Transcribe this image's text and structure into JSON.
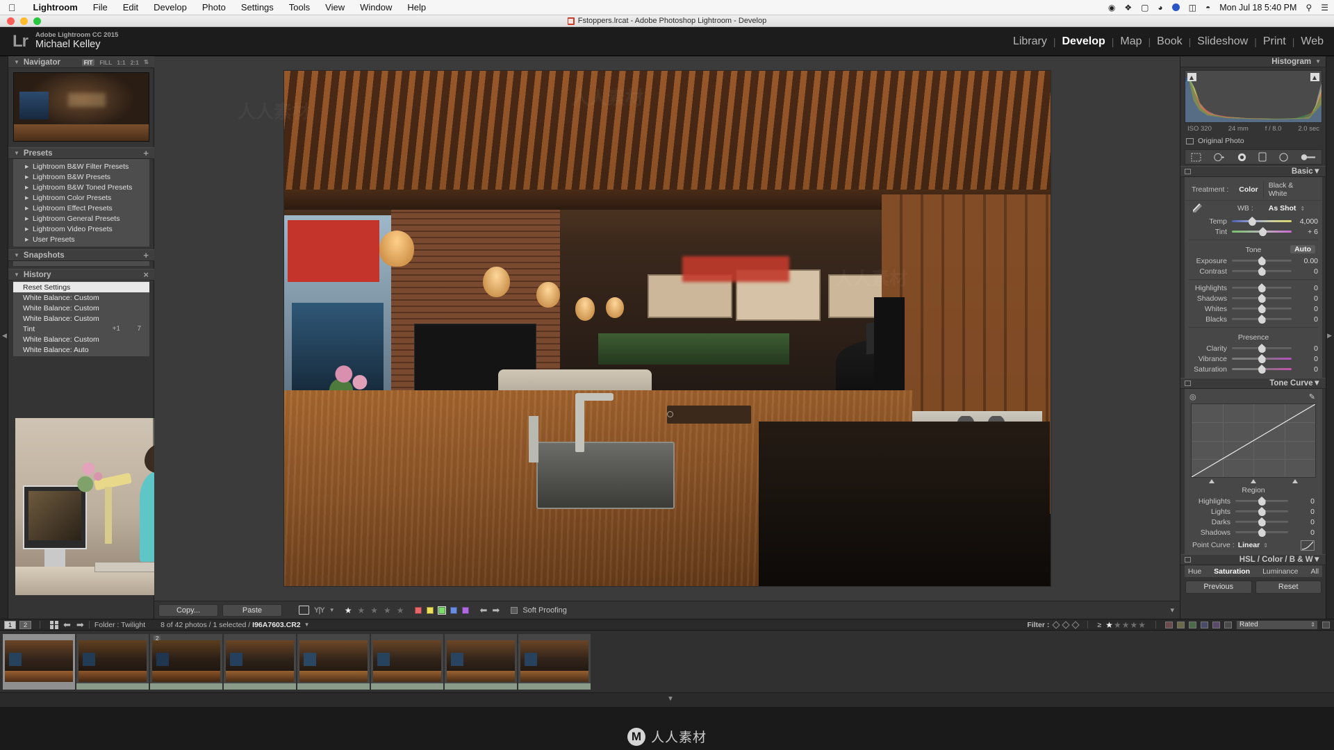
{
  "mac_menu": {
    "apple_icon": "apple-icon",
    "items": [
      "Lightroom",
      "File",
      "Edit",
      "Develop",
      "Photo",
      "Settings",
      "Tools",
      "View",
      "Window",
      "Help"
    ],
    "status_icons": [
      "record-icon",
      "dropbox-icon",
      "app-icon",
      "creative-cloud-icon",
      "blue-dot-icon",
      "airplay-icon",
      "wifi-icon"
    ],
    "clock": "Mon Jul 18  5:40 PM",
    "search_icon": "search-icon",
    "notification_icon": "notification-center-icon"
  },
  "window": {
    "title": "Fstoppers.lrcat - Adobe Photoshop Lightroom - Develop",
    "doc_icon": "lightroom-catalog-icon"
  },
  "identity": {
    "logo": "Lr",
    "product": "Adobe Lightroom CC 2015",
    "user": "Michael Kelley"
  },
  "modules": {
    "items": [
      "Library",
      "Develop",
      "Map",
      "Book",
      "Slideshow",
      "Print",
      "Web"
    ],
    "active": "Develop"
  },
  "left_panel": {
    "navigator": {
      "title": "Navigator",
      "zoom_options": [
        "FIT",
        "FILL",
        "1:1",
        "2:1"
      ],
      "active_zoom": "FIT"
    },
    "presets": {
      "title": "Presets",
      "add_icon": "plus-icon",
      "items": [
        "Lightroom B&W Filter Presets",
        "Lightroom B&W Presets",
        "Lightroom B&W Toned Presets",
        "Lightroom Color Presets",
        "Lightroom Effect Presets",
        "Lightroom General Presets",
        "Lightroom Video Presets",
        "User Presets"
      ]
    },
    "snapshots": {
      "title": "Snapshots",
      "add_icon": "plus-icon"
    },
    "history": {
      "title": "History",
      "clear_icon": "clear-icon",
      "items": [
        {
          "label": "Reset Settings",
          "v1": "",
          "v2": "",
          "selected": true
        },
        {
          "label": "White Balance: Custom",
          "v1": "",
          "v2": "",
          "selected": false
        },
        {
          "label": "White Balance: Custom",
          "v1": "",
          "v2": "",
          "selected": false
        },
        {
          "label": "White Balance: Custom",
          "v1": "",
          "v2": "",
          "selected": false
        },
        {
          "label": "Tint",
          "v1": "+1",
          "v2": "7",
          "selected": false
        },
        {
          "label": "White Balance: Custom",
          "v1": "",
          "v2": "",
          "selected": false
        },
        {
          "label": "White Balance: Auto",
          "v1": "",
          "v2": "",
          "selected": false
        }
      ]
    }
  },
  "toolbar": {
    "copy_label": "Copy...",
    "paste_label": "Paste",
    "view_icon": "loupe-view-icon",
    "compare_icon": "before-after-icon",
    "dropdown_icon": "chevron-down-icon",
    "rating": 1,
    "color_labels": [
      "#e8666a",
      "#ebe05a",
      "#7ada6a",
      "#6a8ce0",
      "#b06ae0"
    ],
    "prev_icon": "arrow-left-icon",
    "next_icon": "arrow-right-icon",
    "soft_proofing_label": "Soft Proofing",
    "soft_proofing_checked": false,
    "toggle_icon": "toolbar-toggle-icon"
  },
  "right_panel": {
    "histogram": {
      "title": "Histogram",
      "shadow_clip_icon": "shadow-clipping-icon",
      "highlight_clip_icon": "highlight-clipping-icon",
      "iso": "ISO 320",
      "focal": "24 mm",
      "aperture": "f / 8.0",
      "shutter": "2.0 sec",
      "original_photo_label": "Original Photo"
    },
    "tools": [
      "crop-overlay-icon",
      "spot-removal-icon",
      "red-eye-icon",
      "graduated-filter-icon",
      "radial-filter-icon",
      "adjustment-brush-icon"
    ],
    "basic": {
      "title": "Basic",
      "treatment_label": "Treatment :",
      "treatment_options": [
        "Color",
        "Black & White"
      ],
      "treatment_active": "Color",
      "eyedropper_icon": "white-balance-selector-icon",
      "wb_label": "WB :",
      "wb_value": "As Shot",
      "wb_dropdown_icon": "chevron-down-icon",
      "wb_sliders": [
        {
          "name": "Temp",
          "value": "4,000",
          "pos": 34,
          "kind": "temp"
        },
        {
          "name": "Tint",
          "value": "+ 6",
          "pos": 52,
          "kind": "tint"
        }
      ],
      "tone_label": "Tone",
      "auto_label": "Auto",
      "tone_sliders": [
        {
          "name": "Exposure",
          "value": "0.00",
          "pos": 50,
          "kind": "plain"
        },
        {
          "name": "Contrast",
          "value": "0",
          "pos": 50,
          "kind": "plain"
        },
        {
          "name": "Highlights",
          "value": "0",
          "pos": 50,
          "kind": "plain"
        },
        {
          "name": "Shadows",
          "value": "0",
          "pos": 50,
          "kind": "plain"
        },
        {
          "name": "Whites",
          "value": "0",
          "pos": 50,
          "kind": "plain"
        },
        {
          "name": "Blacks",
          "value": "0",
          "pos": 50,
          "kind": "plain"
        }
      ],
      "presence_label": "Presence",
      "presence_sliders": [
        {
          "name": "Clarity",
          "value": "0",
          "pos": 50,
          "kind": "plain"
        },
        {
          "name": "Vibrance",
          "value": "0",
          "pos": 50,
          "kind": "vib"
        },
        {
          "name": "Saturation",
          "value": "0",
          "pos": 50,
          "kind": "sat"
        }
      ]
    },
    "tone_curve": {
      "title": "Tone Curve",
      "target_icon": "targeted-adjustment-icon",
      "pencil_icon": "edit-point-curve-icon",
      "region_label": "Region",
      "sliders": [
        {
          "name": "Highlights",
          "value": "0",
          "pos": 50
        },
        {
          "name": "Lights",
          "value": "0",
          "pos": 50
        },
        {
          "name": "Darks",
          "value": "0",
          "pos": 50
        },
        {
          "name": "Shadows",
          "value": "0",
          "pos": 50
        }
      ],
      "point_curve_label": "Point Curve :",
      "point_curve_value": "Linear",
      "point_curve_dropdown_icon": "chevron-down-icon"
    },
    "hsl": {
      "title": "HSL / Color / B & W",
      "tabs": [
        "Hue",
        "Saturation",
        "Luminance",
        "All"
      ],
      "active_tab": "Saturation"
    },
    "footer": {
      "previous_label": "Previous",
      "reset_label": "Reset"
    }
  },
  "filmstrip_bar": {
    "screen1_label": "1",
    "screen2_label": "2",
    "grid_icon": "grid-view-icon",
    "back_icon": "arrow-left-icon",
    "forward_icon": "arrow-right-icon",
    "source_label": "Folder : Twilight",
    "count_label": "8 of 42 photos / 1 selected /",
    "filename": "I96A7603.CR2",
    "filename_dropdown_icon": "chevron-down-icon",
    "filter_label": "Filter :",
    "flag_icons": [
      "flag-pick-icon",
      "flag-unflagged-icon",
      "flag-rejected-icon"
    ],
    "rating_operator": "≥",
    "rating": 1,
    "color_chips": 6,
    "preset_value": "Rated",
    "preset_dropdown_icon": "chevron-down-icon",
    "lock_icon": "filter-lock-icon"
  },
  "filmstrip": {
    "cells": [
      {
        "badge": "",
        "selected": true
      },
      {
        "badge": "",
        "selected": false
      },
      {
        "badge": "2",
        "selected": false
      },
      {
        "badge": "",
        "selected": false
      },
      {
        "badge": "",
        "selected": false
      },
      {
        "badge": "",
        "selected": false
      },
      {
        "badge": "",
        "selected": false
      },
      {
        "badge": "",
        "selected": false
      }
    ]
  },
  "watermark": {
    "logo": "M",
    "text": "人人素材",
    "tile_text": "人人素材社区"
  },
  "colors": {
    "panel_bg": "#343434",
    "canvas_bg": "#3b3b3b",
    "accent_text": "#ffffff",
    "slider_track": "#6a6a6a"
  }
}
